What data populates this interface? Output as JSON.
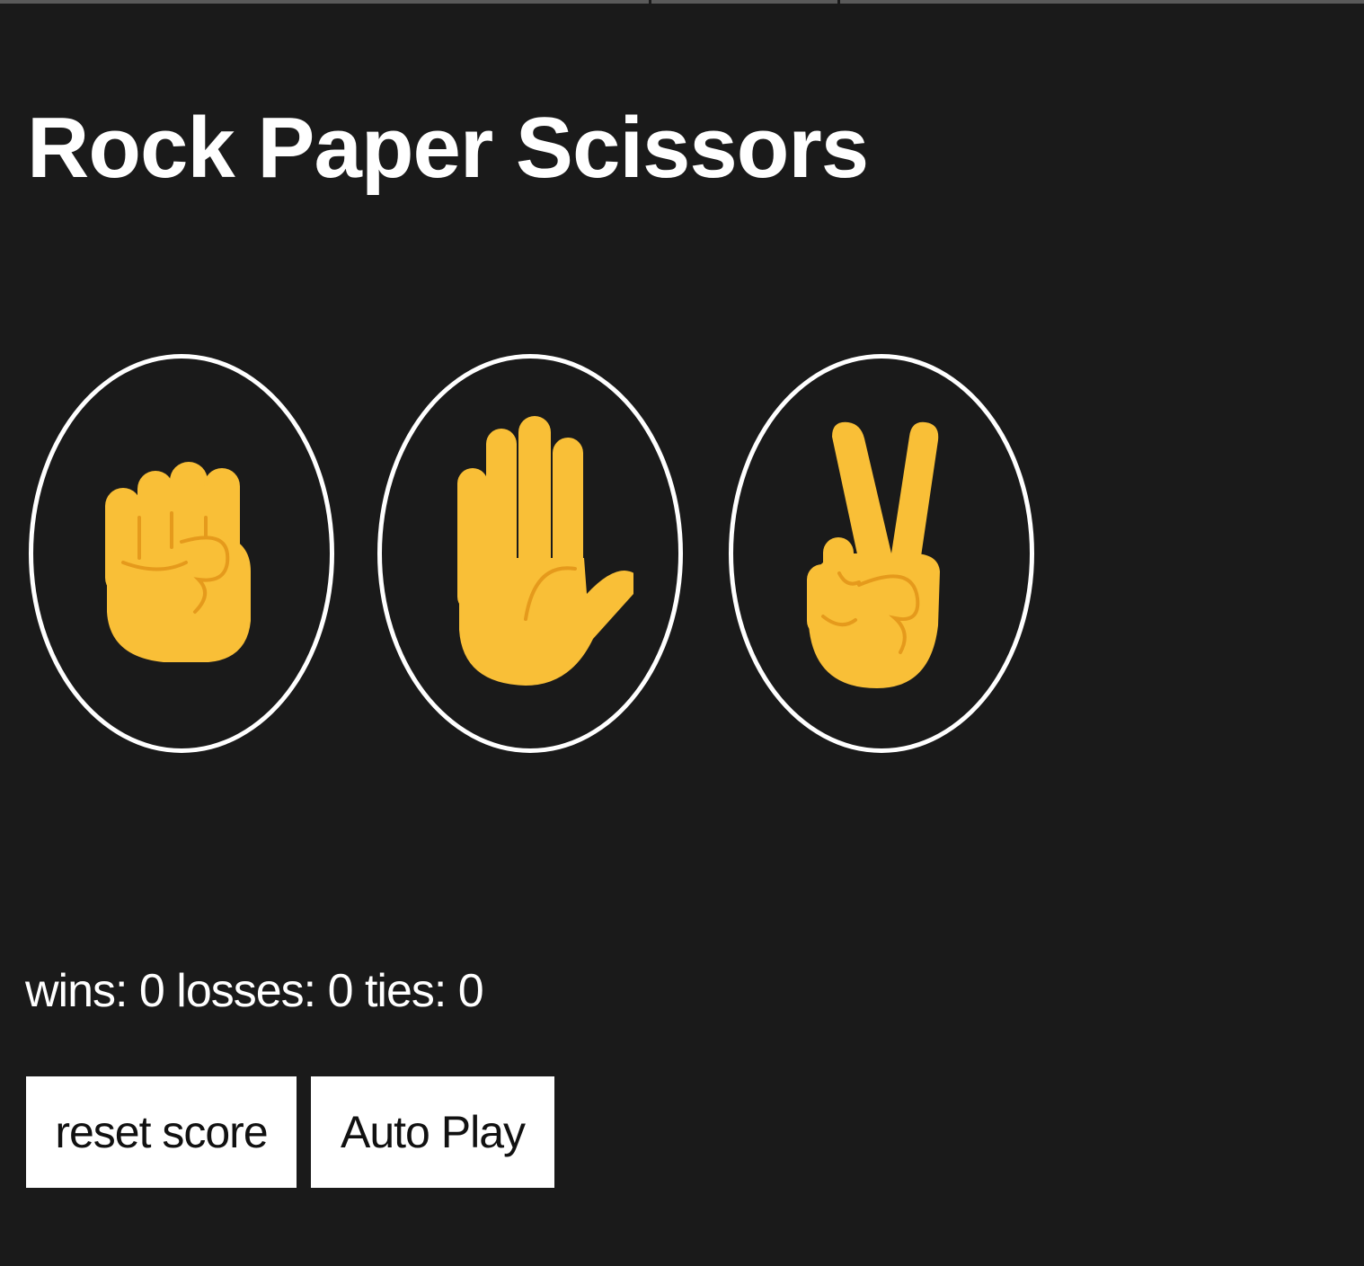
{
  "title": "Rock Paper Scissors",
  "moves": [
    {
      "name": "rock",
      "icon": "raised-fist-icon"
    },
    {
      "name": "paper",
      "icon": "raised-hand-icon"
    },
    {
      "name": "scissors",
      "icon": "victory-hand-icon"
    }
  ],
  "score_text": "wins: 0 losses: 0 ties: 0",
  "buttons": {
    "reset_label": "reset score",
    "auto_play_label": "Auto Play"
  },
  "colors": {
    "background": "#1a1a1a",
    "text": "#ffffff",
    "hand": "#F9BF37",
    "hand_line": "#E59A1C"
  }
}
